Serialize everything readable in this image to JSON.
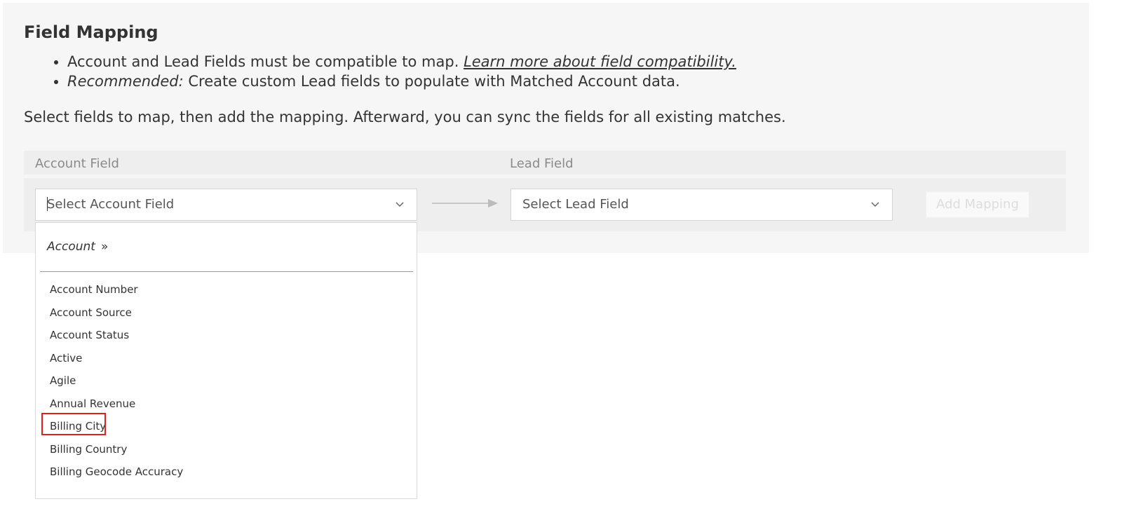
{
  "title": "Field Mapping",
  "bullets": {
    "first_text": "Account and Lead Fields must be compatible to map.",
    "first_link": "Learn more about field compatibility.",
    "second_emphasis": "Recommended:",
    "second_text": "Create custom Lead fields to populate with Matched Account data."
  },
  "instructions": "Select fields to map, then add the mapping. Afterward, you can sync the fields for all existing matches.",
  "columns": {
    "account_field": "Account Field",
    "lead_field": "Lead Field"
  },
  "account_select": {
    "placeholder": "Select Account Field",
    "icon": "chevron-down-icon"
  },
  "lead_select": {
    "placeholder": "Select Lead Field",
    "icon": "chevron-down-icon"
  },
  "add_mapping_label": "Add Mapping",
  "dropdown": {
    "breadcrumb": "Account",
    "breadcrumb_separator": "»",
    "options": [
      "Account Number",
      "Account Source",
      "Account Status",
      "Active",
      "Agile",
      "Annual Revenue",
      "Billing City",
      "Billing Country",
      "Billing Geocode Accuracy"
    ],
    "highlighted_option": "Billing City"
  },
  "colors": {
    "panel_background": "#f6f6f6",
    "highlight_border": "#e0201b"
  }
}
